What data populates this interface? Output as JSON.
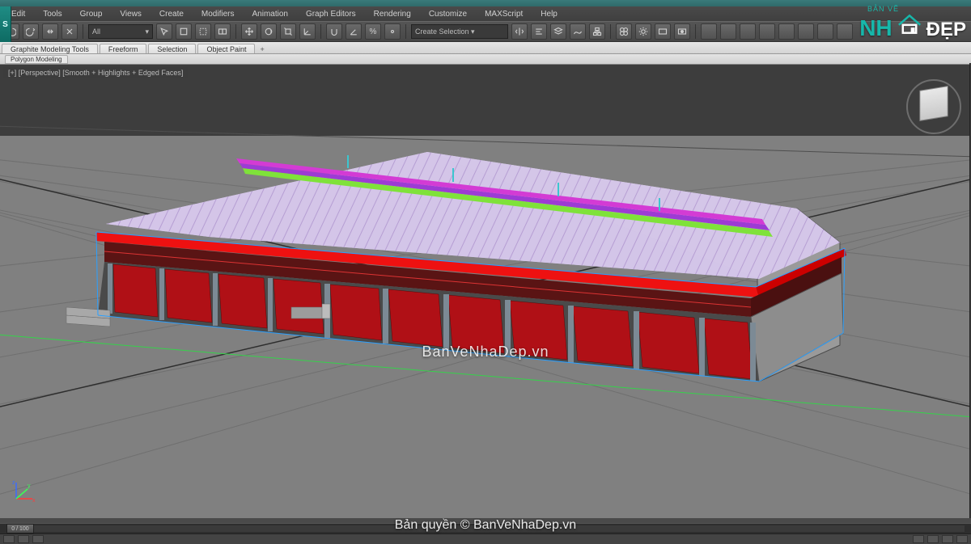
{
  "menu": {
    "items": [
      "Edit",
      "Tools",
      "Group",
      "Views",
      "Create",
      "Modifiers",
      "Animation",
      "Graph Editors",
      "Rendering",
      "Customize",
      "MAXScript",
      "Help"
    ]
  },
  "toolbar": {
    "dropdown1": "All",
    "dropdown2": "Create Selection ▾"
  },
  "ribbon": {
    "tabs": [
      "Graphite Modeling Tools",
      "Freeform",
      "Selection",
      "Object Paint"
    ],
    "plus": "+",
    "subtab": "Polygon Modeling"
  },
  "viewport": {
    "label": "[+] [Perspective] [Smooth + Highlights + Edged Faces]"
  },
  "timeline": {
    "frame": "0 / 100"
  },
  "axis": {
    "x": "x",
    "y": "y",
    "z": "z"
  },
  "watermark": {
    "center": "BanVeNhaDep.vn",
    "bottom": "Bản quyền © BanVeNhaDep.vn",
    "logo_top": "BẢN VẼ",
    "logo_nh": "NH",
    "logo_dep": "ĐẸP"
  },
  "app_button": "S"
}
